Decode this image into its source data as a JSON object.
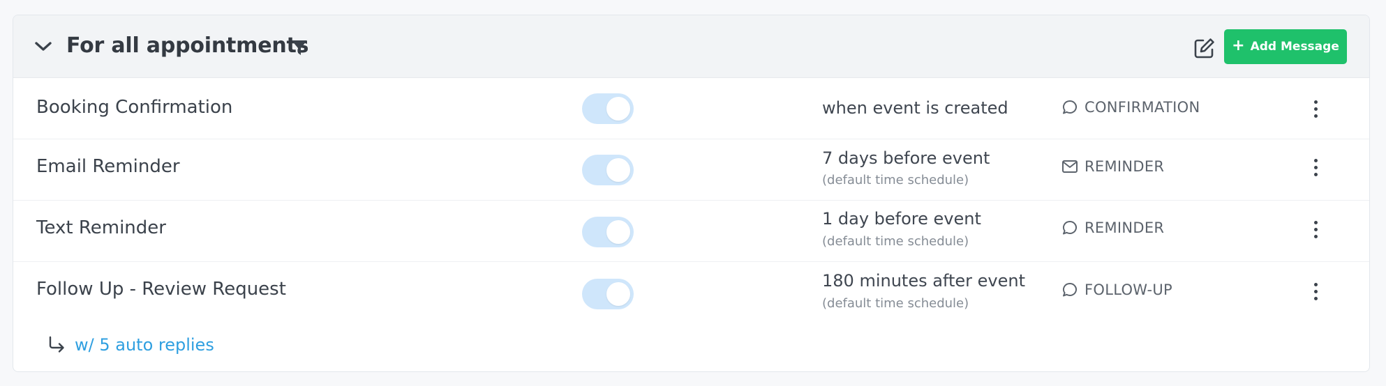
{
  "header": {
    "title": "For all appointments",
    "add_button_label": "Add Message",
    "add_button_color": "#1fc16b"
  },
  "icons": {
    "collapse": "chevron-down-icon",
    "filter": "filter-icon",
    "edit": "edit-icon",
    "add": "plus-icon",
    "chat": "chat-bubble-icon",
    "mail": "mail-icon",
    "menu": "more-vertical-icon",
    "reply": "reply-arrow-icon"
  },
  "messages": [
    {
      "name": "Booking Confirmation",
      "enabled": true,
      "timing": "when event is created",
      "timing_sub": "",
      "type": "CONFIRMATION",
      "type_icon": "chat-bubble-icon"
    },
    {
      "name": "Email Reminder",
      "enabled": true,
      "timing": "7 days before event",
      "timing_sub": "(default time schedule)",
      "type": "REMINDER",
      "type_icon": "mail-icon"
    },
    {
      "name": "Text Reminder",
      "enabled": true,
      "timing": "1 day before event",
      "timing_sub": "(default time schedule)",
      "type": "REMINDER",
      "type_icon": "chat-bubble-icon"
    },
    {
      "name": "Follow Up - Review Request",
      "enabled": true,
      "timing": "180 minutes after event",
      "timing_sub": "(default time schedule)",
      "type": "FOLLOW-UP",
      "type_icon": "chat-bubble-icon"
    }
  ],
  "auto_replies": {
    "label": "w/ 5 auto replies",
    "link_color": "#2f9fe0"
  },
  "colors": {
    "toggle_on": "#cfe6fb",
    "header_bg": "#f2f4f6"
  }
}
